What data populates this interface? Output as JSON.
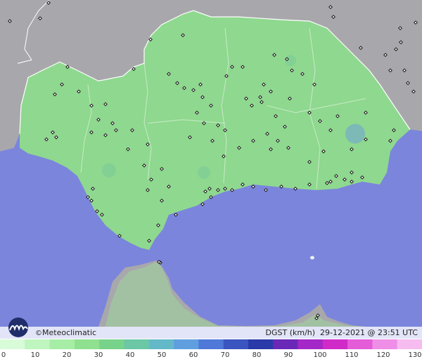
{
  "map": {
    "brand": "Meteoclimatic",
    "brand_symbol": "©",
    "variable": "DGST (km/h)",
    "date": "29-12-2021",
    "time": "23:51 UTC",
    "colors": {
      "sea": "#7b85dc",
      "land_other": "#a6a6a6",
      "land_main": "#8fd88f",
      "border": "#ffffff",
      "station": "#111111"
    }
  },
  "legend": {
    "ticks": [
      "0",
      "10",
      "20",
      "30",
      "40",
      "50",
      "60",
      "70",
      "80",
      "90",
      "100",
      "110",
      "120",
      "130"
    ],
    "colors": [
      "#d8fbd8",
      "#bff5bf",
      "#a6eea6",
      "#8fe08f",
      "#78d38a",
      "#6cc7a6",
      "#64b9c8",
      "#5f9fe0",
      "#4f79d8",
      "#3a55c0",
      "#2a3aa8",
      "#6a28b8",
      "#a428c8",
      "#d02ac8",
      "#e45cd8",
      "#ef8ee6",
      "#f6bcf0"
    ]
  }
}
